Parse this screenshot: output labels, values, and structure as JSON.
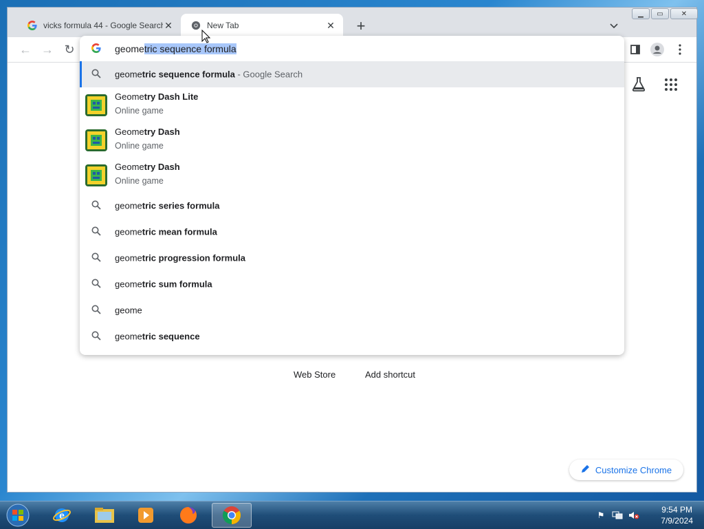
{
  "tabs": [
    {
      "title": "vicks formula 44 - Google Search",
      "state": "inactive"
    },
    {
      "title": "New Tab",
      "state": "active"
    }
  ],
  "omnibox": {
    "typed": "geome",
    "autocomplete": "tric sequence formula",
    "suggestions": [
      {
        "type": "search",
        "prefix": "geome",
        "bold": "tric sequence formula",
        "suffix": " - Google Search",
        "highlighted": true
      },
      {
        "type": "entity",
        "prefix": "Geome",
        "bold": "try Dash Lite",
        "subtitle": "Online game"
      },
      {
        "type": "entity",
        "prefix": "Geome",
        "bold": "try Dash",
        "subtitle": "Online game"
      },
      {
        "type": "entity",
        "prefix": "Geome",
        "bold": "try Dash",
        "subtitle": "Online game"
      },
      {
        "type": "search",
        "prefix": "geome",
        "bold": "tric series formula"
      },
      {
        "type": "search",
        "prefix": "geome",
        "bold": "tric mean formula"
      },
      {
        "type": "search",
        "prefix": "geome",
        "bold": "tric progression formula"
      },
      {
        "type": "search",
        "prefix": "geome",
        "bold": "tric sum formula"
      },
      {
        "type": "search",
        "prefix": "geome",
        "bold": ""
      },
      {
        "type": "search",
        "prefix": "geome",
        "bold": "tric sequence"
      }
    ]
  },
  "ntp": {
    "web_store": "Web Store",
    "add_shortcut": "Add shortcut",
    "customize": "Customize Chrome"
  },
  "taskbar": {
    "time": "9:54 PM",
    "date": "7/9/2024"
  },
  "colors": {
    "accent": "#1a73e8",
    "tabstrip": "#dee1e6",
    "selection": "#a8c7fa"
  }
}
